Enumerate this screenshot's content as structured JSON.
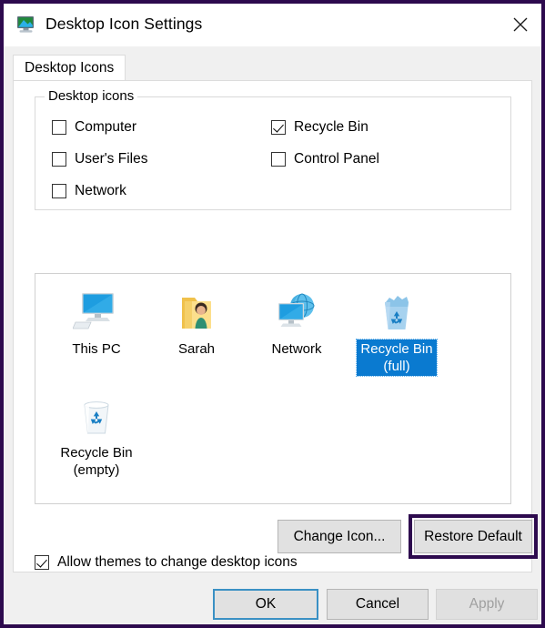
{
  "window": {
    "title": "Desktop Icon Settings",
    "title_icon": "desktop-monitor-icon",
    "close_label": "✕",
    "frame_color": "#2d0a4e"
  },
  "tabs": [
    {
      "label": "Desktop Icons",
      "active": true
    }
  ],
  "group_desktop_icons": {
    "legend": "Desktop icons",
    "checkboxes": [
      {
        "label": "Computer",
        "checked": false
      },
      {
        "label": "User's Files",
        "checked": false
      },
      {
        "label": "Network",
        "checked": false
      },
      {
        "label": "Recycle Bin",
        "checked": true
      },
      {
        "label": "Control Panel",
        "checked": false
      }
    ]
  },
  "preview": {
    "items": [
      {
        "label": "This PC",
        "icon": "monitor-icon",
        "selected": false
      },
      {
        "label": "Sarah",
        "icon": "user-folder-icon",
        "selected": false
      },
      {
        "label": "Network",
        "icon": "network-globe-icon",
        "selected": false
      },
      {
        "label": "Recycle Bin\n(full)",
        "label_line1": "Recycle Bin",
        "label_line2": "(full)",
        "icon": "recycle-bin-full-icon",
        "selected": true
      },
      {
        "label": "Recycle Bin\n(empty)",
        "label_line1": "Recycle Bin",
        "label_line2": "(empty)",
        "icon": "recycle-bin-empty-icon",
        "selected": false
      }
    ],
    "selection_color": "#0a7ad0"
  },
  "buttons": {
    "change_icon": "Change Icon...",
    "restore_default": "Restore Default",
    "ok": "OK",
    "cancel": "Cancel",
    "apply": "Apply",
    "apply_enabled": false
  },
  "allow_themes": {
    "label": "Allow themes to change desktop icons",
    "checked": true
  },
  "annotation": {
    "highlight_target": "Restore Default",
    "highlight_color": "#2d0a4e"
  }
}
